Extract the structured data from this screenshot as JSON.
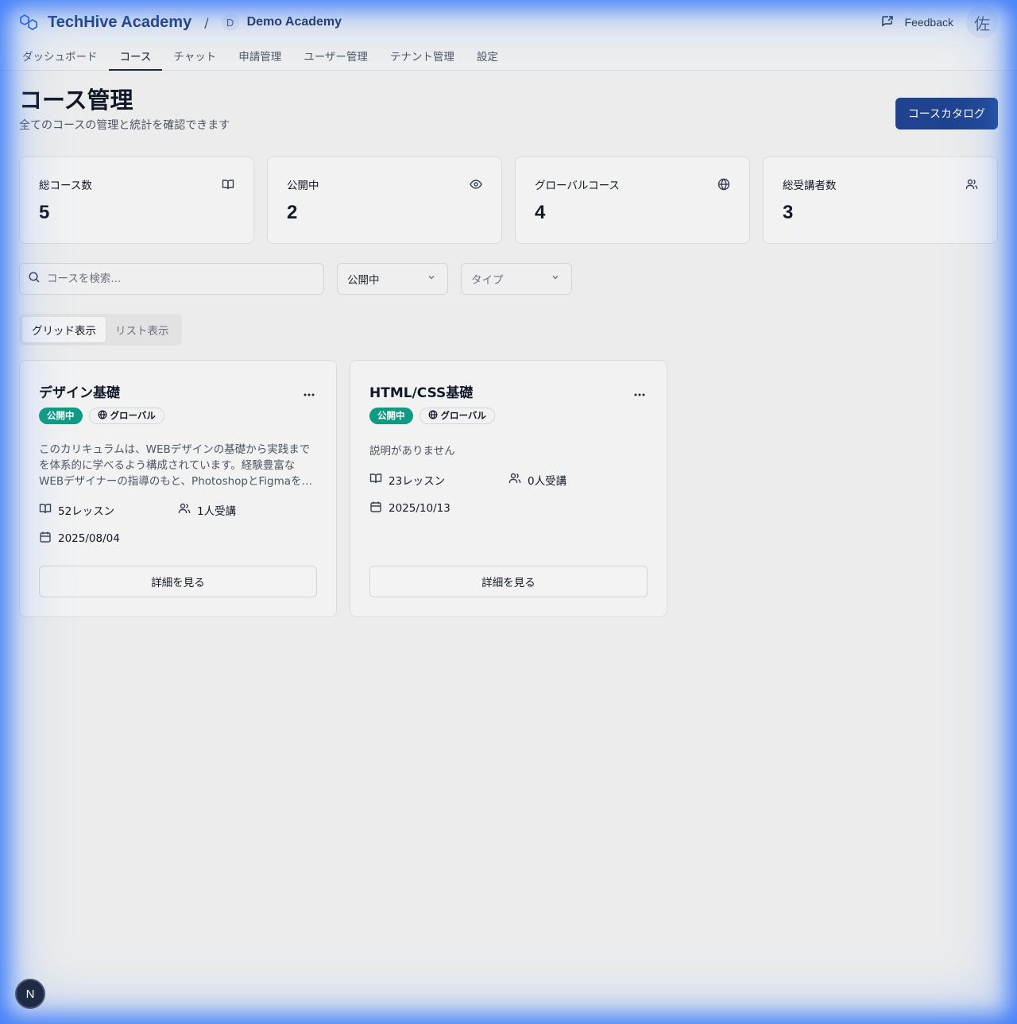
{
  "header": {
    "brand": "TechHive Academy",
    "separator": "/",
    "tenant_initial": "D",
    "tenant_name": "Demo Academy",
    "feedback_label": "Feedback",
    "avatar_initial": "佐"
  },
  "nav": {
    "items": [
      "ダッシュボード",
      "コース",
      "チャット",
      "申請管理",
      "ユーザー管理",
      "テナント管理",
      "設定"
    ],
    "active_index": 1
  },
  "page": {
    "title": "コース管理",
    "subtitle": "全てのコースの管理と統計を確認できます",
    "catalog_button": "コースカタログ"
  },
  "stats": [
    {
      "label": "総コース数",
      "value": "5",
      "icon": "book-open-icon"
    },
    {
      "label": "公開中",
      "value": "2",
      "icon": "eye-icon"
    },
    {
      "label": "グローバルコース",
      "value": "4",
      "icon": "globe-icon"
    },
    {
      "label": "総受講者数",
      "value": "3",
      "icon": "users-icon"
    }
  ],
  "filters": {
    "search_placeholder": "コースを検索...",
    "status_value": "公開中",
    "type_placeholder": "タイプ"
  },
  "view_toggle": {
    "grid": "グリッド表示",
    "list": "リスト表示",
    "active": "grid"
  },
  "courses": [
    {
      "title": "デザイン基礎",
      "status_badge": "公開中",
      "scope_badge": "グローバル",
      "description": "このカリキュラムは、WEBデザインの基礎から実践までを体系的に学べるよう構成されています。経験豊富なWEBデザイナーの指導のもと、PhotoshopとFigmaを…",
      "lessons": "52レッスン",
      "students": "1人受講",
      "date": "2025/08/04",
      "detail_button": "詳細を見る"
    },
    {
      "title": "HTML/CSS基礎",
      "status_badge": "公開中",
      "scope_badge": "グローバル",
      "description": "説明がありません",
      "lessons": "23レッスン",
      "students": "0人受講",
      "date": "2025/10/13",
      "detail_button": "詳細を見る"
    }
  ],
  "dev_badge": "N",
  "colors": {
    "primary": "#1f4391",
    "published": "#0f9b83",
    "brand_text": "#1e3a6e"
  }
}
